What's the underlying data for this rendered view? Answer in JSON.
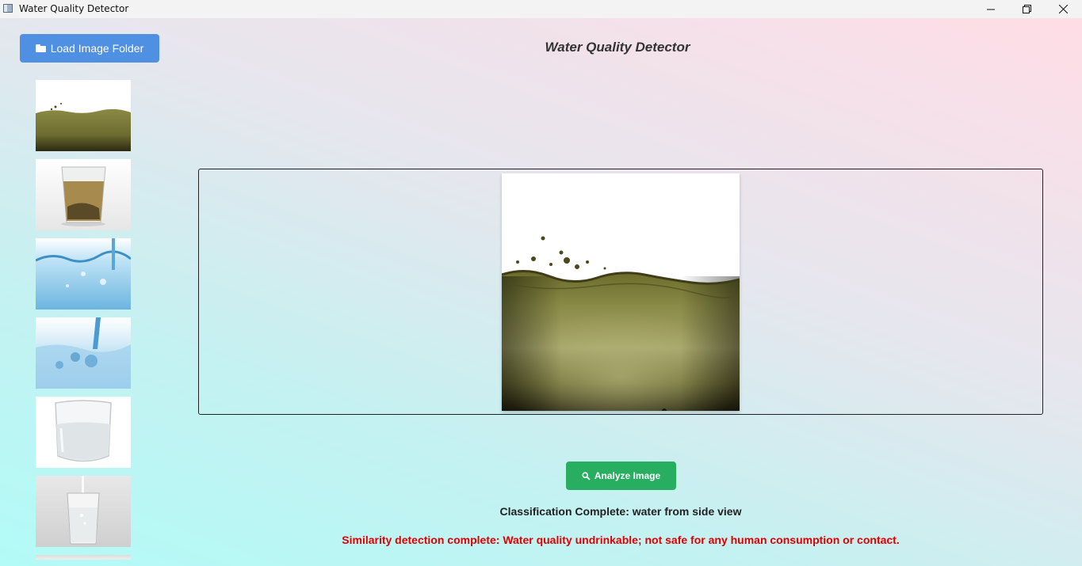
{
  "window": {
    "title": "Water Quality Detector",
    "controls": [
      "minimize-icon",
      "maximize-icon",
      "close-icon"
    ]
  },
  "sidebar": {
    "load_button_label": "Load Image Folder",
    "load_button_icon": "folder-icon",
    "thumbnails": [
      {
        "name": "thumbnail-murky-water-side"
      },
      {
        "name": "thumbnail-glass-dirty-water"
      },
      {
        "name": "thumbnail-blue-splash"
      },
      {
        "name": "thumbnail-pouring-water"
      },
      {
        "name": "thumbnail-glass-clear-water"
      },
      {
        "name": "thumbnail-pouring-glass"
      }
    ]
  },
  "main": {
    "title": "Water Quality Detector",
    "analyze_button_label": "Analyze Image",
    "analyze_button_icon": "magnifier-icon",
    "status_text": "Classification Complete: water from side view",
    "result_text": "Similarity detection complete: Water quality undrinkable; not safe for any human consumption or contact."
  },
  "colors": {
    "load_button": "#4f90e2",
    "analyze_button": "#27ae60",
    "result_text": "#e00000"
  }
}
